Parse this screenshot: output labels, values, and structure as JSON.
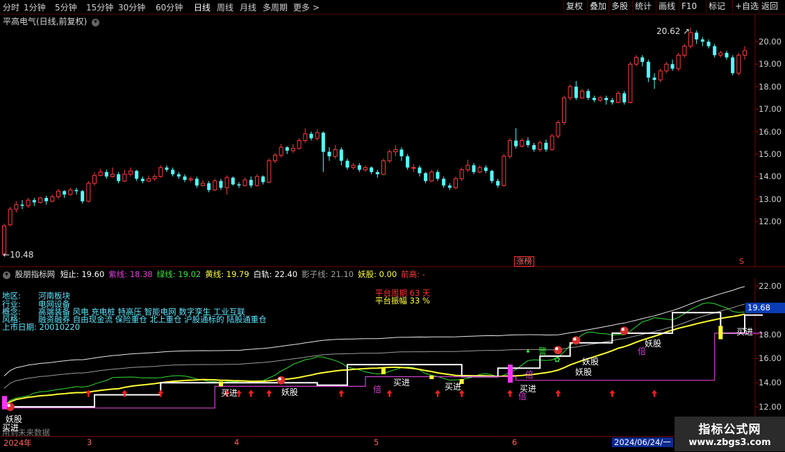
{
  "toolbar": {
    "periods": [
      "分时",
      "1分钟",
      "5分钟",
      "15分钟",
      "30分钟",
      "60分钟",
      "日线",
      "周线",
      "月线",
      "多周期",
      "更多 >"
    ],
    "active_period": "日线",
    "right_buttons": [
      "复权",
      "叠加",
      "多股",
      "统计",
      "画线",
      "F10",
      "标记",
      "+自选",
      "返回"
    ]
  },
  "main": {
    "title": "平高电气(日线,前复权)",
    "high_label": "20.62",
    "low_label": "10.48",
    "zhangbang": "涨榜",
    "scroll_label": "S",
    "y_ticks": [
      "20.00",
      "19.00",
      "18.00",
      "17.00",
      "16.00",
      "15.00",
      "14.00",
      "13.00",
      "12.00"
    ]
  },
  "indicator": {
    "name": "股朋指标网",
    "items": [
      {
        "label": "短止:",
        "value": "19.60",
        "color": "#ffffff"
      },
      {
        "label": "紫线:",
        "value": "18.38",
        "color": "#e040e0"
      },
      {
        "label": "绿线:",
        "value": "19.02",
        "color": "#40e040"
      },
      {
        "label": "黄线:",
        "value": "19.79",
        "color": "#ffff40"
      },
      {
        "label": "白轨:",
        "value": "22.40",
        "color": "#ffffff"
      },
      {
        "label": "影子线:",
        "value": "21.10",
        "color": "#a0a0a0"
      },
      {
        "label": "妖股:",
        "value": "0.00",
        "color": "#ffff40"
      },
      {
        "label": "前高:",
        "value": "-",
        "color": "#ff4040"
      }
    ],
    "y_ticks": [
      "22.00",
      "20.00",
      "18.00",
      "16.00",
      "14.00",
      "12.00"
    ],
    "current_value": "19.68",
    "info": [
      {
        "k": "地区:",
        "v": "河南板块"
      },
      {
        "k": "行业:",
        "v": "电网设备"
      },
      {
        "k": "概念:",
        "v": "高端装备 风电 充电桩 特高压 智能电网 数字孪生 工业互联"
      },
      {
        "k": "风格:",
        "v": "融资融券 自由现金流 保险重仓 北上重仓 沪股通标的 陆股通重仓"
      }
    ],
    "listing": "上市日期: 20010220",
    "platform_period": "平台周期 63 天",
    "platform_amp": "平台振幅 33 %",
    "future_note": "用到未来数据",
    "signals": {
      "buy": "买进",
      "demon": "妖股",
      "double": "倍",
      "alert": "警"
    }
  },
  "date_axis": {
    "labels": [
      "2024年",
      "3",
      "4",
      "5",
      "6"
    ],
    "cursor_date": "2024/06/24/一"
  },
  "watermark": {
    "line1": "指标公式网",
    "line2": "www.zbgs3.com"
  },
  "chart_data": {
    "type": "candlestick",
    "title": "平高电气(日线,前复权)",
    "ylim": [
      10.0,
      21.0
    ],
    "high": 20.62,
    "low": 10.48,
    "candles": [
      [
        10.55,
        11.8,
        10.48,
        11.9
      ],
      [
        11.85,
        12.55,
        11.8,
        12.65
      ],
      [
        12.55,
        12.75,
        12.4,
        12.9
      ],
      [
        12.75,
        12.7,
        12.55,
        12.95
      ],
      [
        12.7,
        12.95,
        12.6,
        13.05
      ],
      [
        12.95,
        12.85,
        12.7,
        13.05
      ],
      [
        12.85,
        13.05,
        12.8,
        13.1
      ],
      [
        13.05,
        12.9,
        12.75,
        13.15
      ],
      [
        12.9,
        13.1,
        12.85,
        13.2
      ],
      [
        13.1,
        13.35,
        13.0,
        13.45
      ],
      [
        13.35,
        13.2,
        13.05,
        13.4
      ],
      [
        13.2,
        13.4,
        13.15,
        13.5
      ],
      [
        13.4,
        13.35,
        13.2,
        13.5
      ],
      [
        13.35,
        12.9,
        12.8,
        13.4
      ],
      [
        12.9,
        13.7,
        12.85,
        13.8
      ],
      [
        13.7,
        14.05,
        13.6,
        14.2
      ],
      [
        14.05,
        14.2,
        14.0,
        14.35
      ],
      [
        14.2,
        14.0,
        13.9,
        14.3
      ],
      [
        14.0,
        14.1,
        13.95,
        14.4
      ],
      [
        14.1,
        13.8,
        13.7,
        14.2
      ],
      [
        13.8,
        14.1,
        13.75,
        14.3
      ],
      [
        14.1,
        14.25,
        14.0,
        14.4
      ],
      [
        14.25,
        13.9,
        13.8,
        14.3
      ],
      [
        13.9,
        13.8,
        13.7,
        14.0
      ],
      [
        13.8,
        13.9,
        13.75,
        14.05
      ],
      [
        13.9,
        14.0,
        13.8,
        14.1
      ],
      [
        14.0,
        14.4,
        13.95,
        14.5
      ],
      [
        14.4,
        14.3,
        14.2,
        14.5
      ],
      [
        14.3,
        14.1,
        14.0,
        14.4
      ],
      [
        14.1,
        14.0,
        13.9,
        14.2
      ],
      [
        14.0,
        13.85,
        13.75,
        14.1
      ],
      [
        13.85,
        13.9,
        13.75,
        14.0
      ],
      [
        13.9,
        13.6,
        13.5,
        14.0
      ],
      [
        13.6,
        13.7,
        13.55,
        13.85
      ],
      [
        13.7,
        13.4,
        13.3,
        13.8
      ],
      [
        13.4,
        13.8,
        13.35,
        13.9
      ],
      [
        13.8,
        13.5,
        13.4,
        13.9
      ],
      [
        13.5,
        13.95,
        13.2,
        14.05
      ],
      [
        13.95,
        13.65,
        13.6,
        14.0
      ],
      [
        13.65,
        13.6,
        13.5,
        13.75
      ],
      [
        13.6,
        13.85,
        13.55,
        13.95
      ],
      [
        13.85,
        13.6,
        13.5,
        14.0
      ],
      [
        13.6,
        14.0,
        13.55,
        14.1
      ],
      [
        14.0,
        13.75,
        13.65,
        14.05
      ],
      [
        13.75,
        14.7,
        13.7,
        14.8
      ],
      [
        14.7,
        14.95,
        14.6,
        15.05
      ],
      [
        14.95,
        15.3,
        14.85,
        15.45
      ],
      [
        15.3,
        15.15,
        15.0,
        15.35
      ],
      [
        15.15,
        15.25,
        15.05,
        15.45
      ],
      [
        15.25,
        15.6,
        15.2,
        15.7
      ],
      [
        15.6,
        15.9,
        15.5,
        16.15
      ],
      [
        15.9,
        15.7,
        15.6,
        16.0
      ],
      [
        15.7,
        15.95,
        15.6,
        16.1
      ],
      [
        15.95,
        15.1,
        14.2,
        16.0
      ],
      [
        15.1,
        14.9,
        14.7,
        15.3
      ],
      [
        14.9,
        15.2,
        14.8,
        15.4
      ],
      [
        15.2,
        14.7,
        14.5,
        15.3
      ],
      [
        14.7,
        14.4,
        14.3,
        14.8
      ],
      [
        14.4,
        14.5,
        14.3,
        14.6
      ],
      [
        14.5,
        14.3,
        14.2,
        14.6
      ],
      [
        14.3,
        14.4,
        14.2,
        14.5
      ],
      [
        14.4,
        14.2,
        14.1,
        14.45
      ],
      [
        14.2,
        14.1,
        13.95,
        14.3
      ],
      [
        14.1,
        14.7,
        14.05,
        14.8
      ],
      [
        14.7,
        15.1,
        14.6,
        15.2
      ],
      [
        15.1,
        15.2,
        14.9,
        15.4
      ],
      [
        15.2,
        14.9,
        14.7,
        15.3
      ],
      [
        14.9,
        14.4,
        14.3,
        15.0
      ],
      [
        14.4,
        14.4,
        14.2,
        14.55
      ],
      [
        14.4,
        14.15,
        14.0,
        14.5
      ],
      [
        14.15,
        13.8,
        13.7,
        14.2
      ],
      [
        13.8,
        14.2,
        13.75,
        14.3
      ],
      [
        14.2,
        13.9,
        13.8,
        14.3
      ],
      [
        13.9,
        13.6,
        13.5,
        14.0
      ],
      [
        13.6,
        13.5,
        13.4,
        13.7
      ],
      [
        13.5,
        13.9,
        13.45,
        14.0
      ],
      [
        13.9,
        14.3,
        13.8,
        14.4
      ],
      [
        14.3,
        14.5,
        14.2,
        14.75
      ],
      [
        14.5,
        14.2,
        14.1,
        14.6
      ],
      [
        14.2,
        14.4,
        14.15,
        14.5
      ],
      [
        14.4,
        14.25,
        14.15,
        14.5
      ],
      [
        14.25,
        13.8,
        13.7,
        14.3
      ],
      [
        13.8,
        13.6,
        13.5,
        13.9
      ],
      [
        13.6,
        14.9,
        13.55,
        15.0
      ],
      [
        14.9,
        15.6,
        14.8,
        15.7
      ],
      [
        15.6,
        15.35,
        15.25,
        16.15
      ],
      [
        15.35,
        15.6,
        15.3,
        15.7
      ],
      [
        15.6,
        15.4,
        15.3,
        15.75
      ],
      [
        15.4,
        15.2,
        15.1,
        15.5
      ],
      [
        15.2,
        15.5,
        15.1,
        15.6
      ],
      [
        15.5,
        15.2,
        15.1,
        15.65
      ],
      [
        15.2,
        15.8,
        15.15,
        15.9
      ],
      [
        15.8,
        16.4,
        15.7,
        16.5
      ],
      [
        16.4,
        17.5,
        16.3,
        17.6
      ],
      [
        17.5,
        18.0,
        17.4,
        18.1
      ],
      [
        18.0,
        17.5,
        17.4,
        18.25
      ],
      [
        17.5,
        17.8,
        17.45,
        17.9
      ],
      [
        17.8,
        17.5,
        17.4,
        17.9
      ],
      [
        17.5,
        17.4,
        17.3,
        17.6
      ],
      [
        17.4,
        17.5,
        17.3,
        17.6
      ],
      [
        17.5,
        17.4,
        17.2,
        17.6
      ],
      [
        17.4,
        17.3,
        17.2,
        17.5
      ],
      [
        17.3,
        17.7,
        17.25,
        17.8
      ],
      [
        17.7,
        17.3,
        17.2,
        17.8
      ],
      [
        17.3,
        19.0,
        17.25,
        19.1
      ],
      [
        19.0,
        19.3,
        18.9,
        19.4
      ],
      [
        19.3,
        19.1,
        18.9,
        19.4
      ],
      [
        19.1,
        18.4,
        18.2,
        19.2
      ],
      [
        18.4,
        18.3,
        17.9,
        18.6
      ],
      [
        18.3,
        18.7,
        18.2,
        18.8
      ],
      [
        18.7,
        19.0,
        18.6,
        19.1
      ],
      [
        19.0,
        18.8,
        18.7,
        19.2
      ],
      [
        18.8,
        19.4,
        18.7,
        19.5
      ],
      [
        19.4,
        19.8,
        19.3,
        19.9
      ],
      [
        19.8,
        20.4,
        19.7,
        20.62
      ],
      [
        20.4,
        20.1,
        19.9,
        20.5
      ],
      [
        20.1,
        20.0,
        19.8,
        20.2
      ],
      [
        20.0,
        19.8,
        19.7,
        20.1
      ],
      [
        19.8,
        19.4,
        19.3,
        19.9
      ],
      [
        19.4,
        19.5,
        19.3,
        19.6
      ],
      [
        19.5,
        19.3,
        19.2,
        19.6
      ],
      [
        19.3,
        18.6,
        18.5,
        19.4
      ],
      [
        18.6,
        19.4,
        18.5,
        19.5
      ],
      [
        19.4,
        19.6,
        19.2,
        19.8
      ]
    ]
  }
}
